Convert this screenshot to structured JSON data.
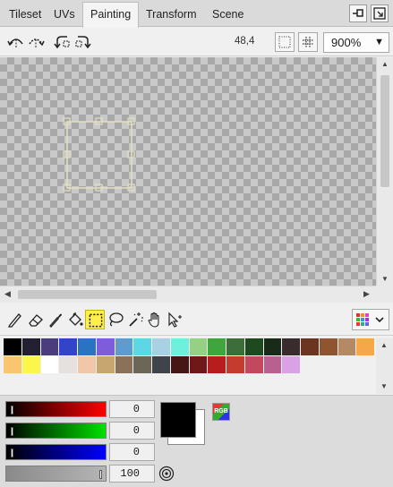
{
  "tabs": [
    {
      "label": "Tileset"
    },
    {
      "label": "UVs"
    },
    {
      "label": "Painting",
      "active": true
    },
    {
      "label": "Transform"
    },
    {
      "label": "Scene"
    }
  ],
  "toolbar": {
    "coordinate_readout": "48,4",
    "zoom_value": "900%"
  },
  "icons": {
    "rotate_left": "rotate-left-icon",
    "flip": "flip-icon",
    "rotate_ccw": "rotate-ccw-icon",
    "rotate_cw": "rotate-cw-icon",
    "grid_fine": "grid-dots-icon",
    "grid": "grid-icon",
    "tileset_grid": "tileset-grid-icon"
  },
  "tools": [
    {
      "name": "pencil-icon"
    },
    {
      "name": "eraser-icon"
    },
    {
      "name": "eyedropper-icon"
    },
    {
      "name": "fill-bucket-icon"
    },
    {
      "name": "rect-select-icon",
      "selected": true
    },
    {
      "name": "lasso-icon"
    },
    {
      "name": "magic-wand-icon"
    },
    {
      "name": "hand-icon"
    },
    {
      "name": "move-icon"
    }
  ],
  "palette": {
    "row1": [
      "#000000",
      "#232033",
      "#4b3c7d",
      "#3245c6",
      "#2a72c2",
      "#7e5ddb",
      "#5e9bd0",
      "#5dd7e4",
      "#a8d1e3",
      "#6ff0dd",
      "#94d185",
      "#3ea63d",
      "#3b6e38",
      "#1f4a1f",
      "#182a18",
      "#3a2c2c",
      "#6b3520",
      "#8f5531",
      "#b38a63",
      "#f5a74a"
    ],
    "row2": [
      "#f9c571",
      "#fbf54c",
      "#ffffff",
      "#e6e1dd",
      "#f0c8a8",
      "#c8a66f",
      "#8a7157",
      "#6e6559",
      "#3f444b",
      "#461515",
      "#701818",
      "#b71d1d",
      "#c53b2e",
      "#c2485e",
      "#b86090",
      "#dba1e6"
    ]
  },
  "mixer": {
    "red": {
      "value": "0",
      "level": 0
    },
    "green": {
      "value": "0",
      "level": 0
    },
    "blue": {
      "value": "0",
      "level": 0
    },
    "alpha": {
      "value": "100",
      "level": 1
    },
    "rgb_label": "RGB",
    "foreground_color": "#000000",
    "background_color": "#ffffff"
  }
}
